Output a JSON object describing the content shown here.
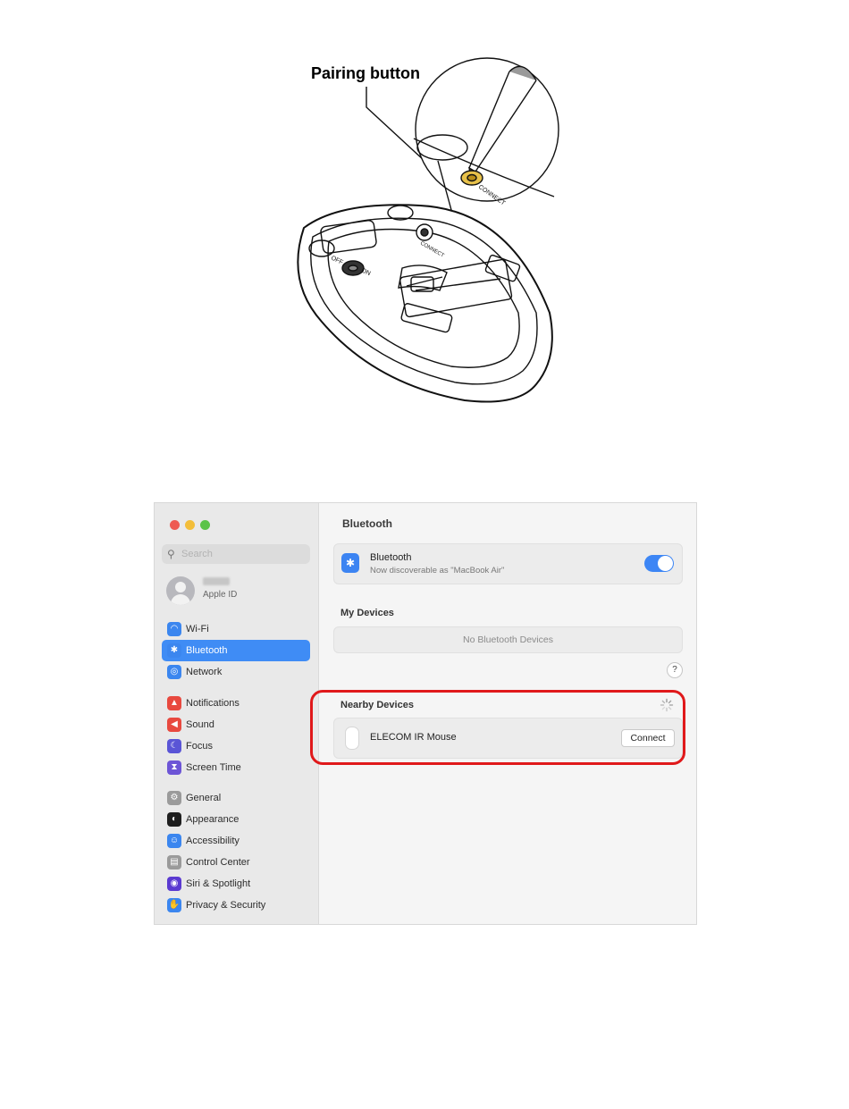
{
  "illustration": {
    "pairing_label": "Pairing button",
    "connect_text": "CONNECT",
    "on_text": "ON",
    "off_text": "OFF"
  },
  "window": {
    "search": {
      "placeholder": "Search"
    },
    "account": {
      "subtitle": "Apple ID"
    },
    "sidebar": {
      "groups": [
        [
          {
            "label": "Wi-Fi",
            "icon": "wifi-icon",
            "color": "#3b86ef",
            "active": false
          },
          {
            "label": "Bluetooth",
            "icon": "bluetooth-icon",
            "color": "#3b86ef",
            "active": true
          },
          {
            "label": "Network",
            "icon": "globe-icon",
            "color": "#3b86ef",
            "active": false
          }
        ],
        [
          {
            "label": "Notifications",
            "icon": "bell-icon",
            "color": "#e8493f",
            "active": false
          },
          {
            "label": "Sound",
            "icon": "speaker-icon",
            "color": "#e8493f",
            "active": false
          },
          {
            "label": "Focus",
            "icon": "moon-icon",
            "color": "#5a55d6",
            "active": false
          },
          {
            "label": "Screen Time",
            "icon": "hourglass-icon",
            "color": "#6d55d6",
            "active": false
          }
        ],
        [
          {
            "label": "General",
            "icon": "gear-icon",
            "color": "#9a9a9a",
            "active": false
          },
          {
            "label": "Appearance",
            "icon": "appearance-icon",
            "color": "#1e1e1e",
            "active": false
          },
          {
            "label": "Accessibility",
            "icon": "accessibility-icon",
            "color": "#3b86ef",
            "active": false
          },
          {
            "label": "Control Center",
            "icon": "control-center-icon",
            "color": "#9a9a9a",
            "active": false
          },
          {
            "label": "Siri & Spotlight",
            "icon": "siri-icon",
            "color": "#5b3ad1",
            "active": false
          },
          {
            "label": "Privacy & Security",
            "icon": "hand-icon",
            "color": "#3b86ef",
            "active": false
          }
        ]
      ]
    },
    "main": {
      "title": "Bluetooth",
      "bluetooth_row": {
        "title": "Bluetooth",
        "subtitle": "Now discoverable as \"MacBook Air\"",
        "enabled": true
      },
      "my_devices": {
        "heading": "My Devices",
        "empty_text": "No Bluetooth Devices"
      },
      "help": "?",
      "nearby": {
        "heading": "Nearby Devices",
        "devices": [
          {
            "name": "ELECOM IR Mouse",
            "action": "Connect"
          }
        ]
      }
    },
    "colors": {
      "highlight": "#e0191b",
      "accent": "#3f8cf5"
    }
  }
}
